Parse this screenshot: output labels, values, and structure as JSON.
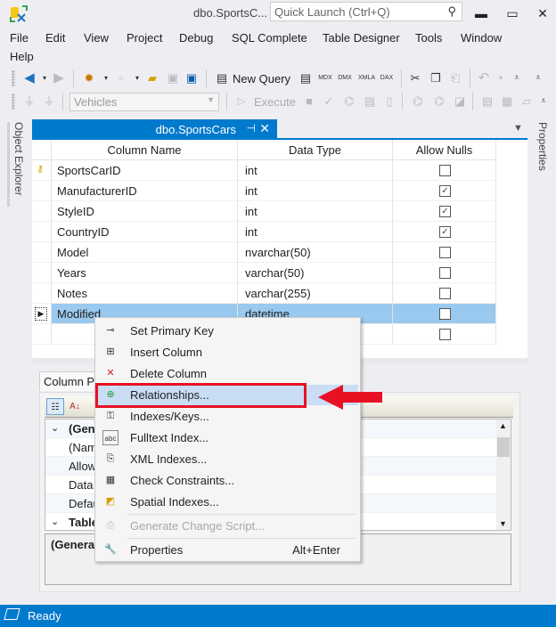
{
  "window": {
    "title": "dbo.SportsC...",
    "quick_launch_placeholder": "Quick Launch (Ctrl+Q)",
    "minimize": "▬",
    "maximize": "▭",
    "close": "✕"
  },
  "menu": [
    "File",
    "Edit",
    "View",
    "Project",
    "Debug",
    "SQL Complete",
    "Table Designer",
    "Tools",
    "Window",
    "Help"
  ],
  "toolbar": {
    "new_query_label": "New Query",
    "database_combo_value": "Vehicles",
    "execute_label": "Execute",
    "query_types": [
      "MDX",
      "DMX",
      "XMLA",
      "DAX"
    ]
  },
  "side_tabs": {
    "left": "Object Explorer",
    "right": "Properties"
  },
  "document_tab": {
    "title": "dbo.SportsCars",
    "pin": "⊣",
    "close": "✕"
  },
  "designer": {
    "headers": [
      "Column Name",
      "Data Type",
      "Allow Nulls"
    ],
    "rows": [
      {
        "name": "SportsCarID",
        "type": "int",
        "allow_nulls": false,
        "primary_key": true
      },
      {
        "name": "ManufacturerID",
        "type": "int",
        "allow_nulls": true
      },
      {
        "name": "StyleID",
        "type": "int",
        "allow_nulls": true
      },
      {
        "name": "CountryID",
        "type": "int",
        "allow_nulls": true
      },
      {
        "name": "Model",
        "type": "nvarchar(50)",
        "allow_nulls": false
      },
      {
        "name": "Years",
        "type": "varchar(50)",
        "allow_nulls": false
      },
      {
        "name": "Notes",
        "type": "varchar(255)",
        "allow_nulls": false
      },
      {
        "name": "Modified",
        "type": "datetime",
        "allow_nulls": false,
        "selected": true
      },
      {
        "name": "",
        "type": "",
        "allow_nulls": false
      }
    ]
  },
  "column_properties": {
    "tab_label": "Column Pr",
    "rows": [
      {
        "label": "(Gen",
        "category": true
      },
      {
        "label": "(Nam"
      },
      {
        "label": "Allow"
      },
      {
        "label": "Data"
      },
      {
        "label": "Defau"
      },
      {
        "label": "Table",
        "category": true
      }
    ],
    "description_title": "(General"
  },
  "context_menu": {
    "items": [
      {
        "label": "Set Primary Key",
        "icon": "key-icon",
        "glyph": "⊸"
      },
      {
        "label": "Insert Column",
        "icon": "insert-column-icon",
        "glyph": "⊞"
      },
      {
        "label": "Delete Column",
        "icon": "delete-column-icon",
        "glyph": "✕"
      },
      {
        "label": "Relationships...",
        "icon": "relationships-icon",
        "glyph": "⊕",
        "highlighted": true
      },
      {
        "label": "Indexes/Keys...",
        "icon": "indexes-keys-icon",
        "glyph": "⚿"
      },
      {
        "label": "Fulltext Index...",
        "icon": "fulltext-index-icon",
        "glyph": "abc"
      },
      {
        "label": "XML Indexes...",
        "icon": "xml-indexes-icon",
        "glyph": "⎘"
      },
      {
        "label": "Check Constraints...",
        "icon": "check-constraints-icon",
        "glyph": "▦"
      },
      {
        "label": "Spatial Indexes...",
        "icon": "spatial-indexes-icon",
        "glyph": "◩"
      },
      {
        "label": "Generate Change Script...",
        "icon": "generate-script-icon",
        "glyph": "⎙",
        "disabled": true
      },
      {
        "label": "Properties",
        "icon": "wrench-icon",
        "glyph": "🔧",
        "shortcut": "Alt+Enter"
      }
    ]
  },
  "annotation": {
    "highlight_color": "#e81123",
    "arrow_color": "#e81123"
  },
  "statusbar": {
    "text": "Ready"
  },
  "colors": {
    "accent": "#007acc",
    "selected_row": "#99c9ef",
    "menu_highlight": "#c9def5"
  }
}
